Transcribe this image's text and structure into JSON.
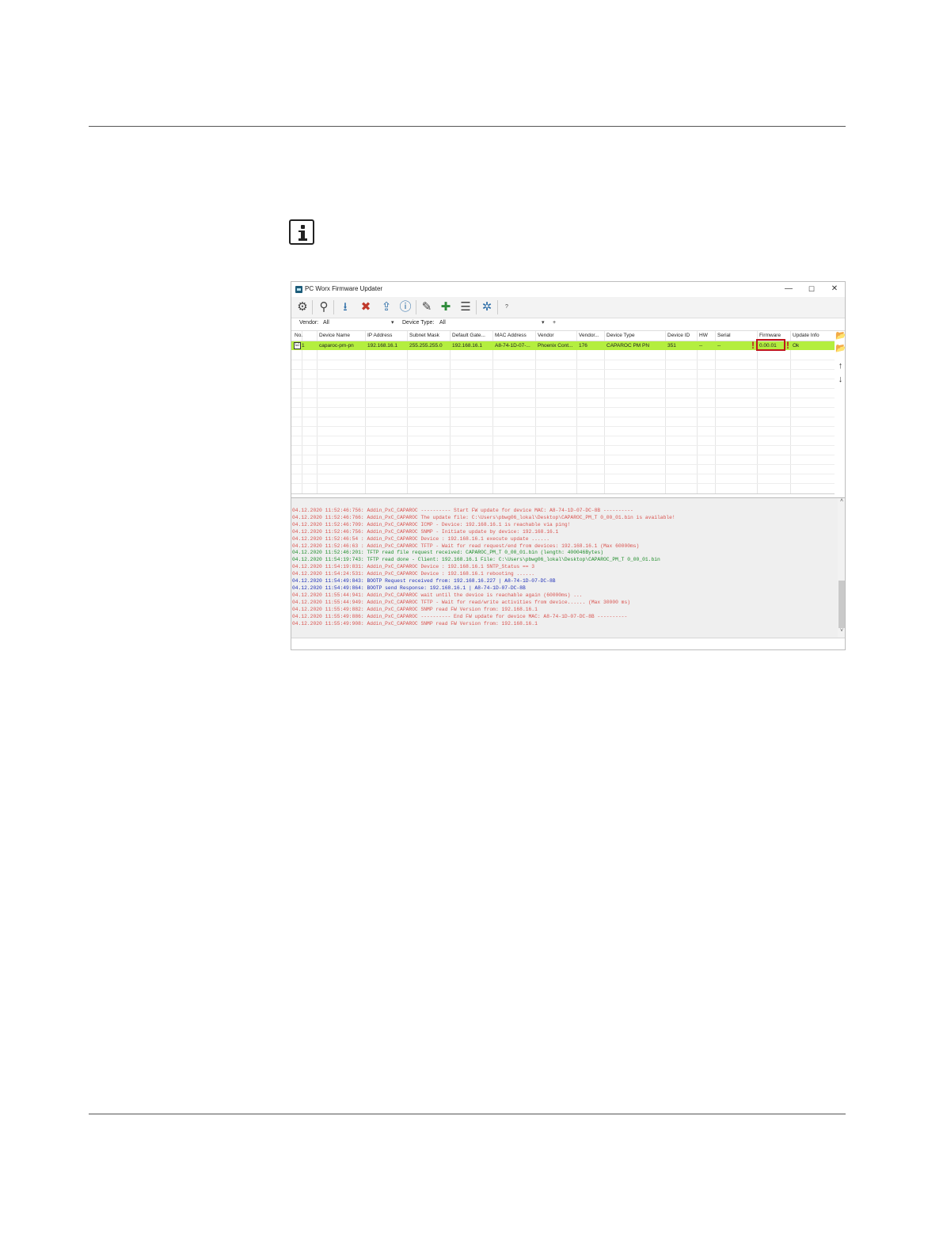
{
  "window": {
    "title": "PC Worx Firmware Updater",
    "minimize_glyph": "—",
    "maximize_glyph": "☐",
    "close_glyph": "✕"
  },
  "toolbar": {
    "help_label": "?",
    "icons": [
      "gear-icon",
      "search-icon",
      "download-icon",
      "search-remove-icon",
      "device-upload-icon",
      "info-upload-icon",
      "edit-minus-icon",
      "add-icon",
      "search-list-icon",
      "settings-icon"
    ]
  },
  "filters": {
    "vendor_label": "Vendor:",
    "vendor_value": "All",
    "device_type_label": "Device Type:",
    "device_type_value": "All",
    "add_glyph": "+"
  },
  "grid": {
    "columns": [
      "No.",
      "Device Name",
      "IP Address",
      "Subnet Mask",
      "Default Gate...",
      "MAC Address",
      "Vendor",
      "Vendor...",
      "Device Type",
      "Device ID",
      "HW",
      "Serial",
      "Firmware",
      "Update Info"
    ],
    "rows": [
      {
        "no": "1",
        "device_name": "caparoc-pm-pn",
        "ip": "192.168.16.1",
        "subnet": "255.255.255.0",
        "gateway": "192.168.16.1",
        "mac": "A8-74-1D-07-...",
        "vendor": "Phoenix Cont...",
        "vendor_id": "176",
        "device_type": "CAPAROC PM PN",
        "device_id": "351",
        "hw": "--",
        "serial": "--",
        "firmware": "0.00.01",
        "update_info": "Ok",
        "checked": "☑"
      }
    ],
    "warn_glyph": "!"
  },
  "side_icons": {
    "open_folder_1": "📂",
    "open_folder_2": "📂",
    "up_arrow": "↑",
    "down_arrow": "↓"
  },
  "log": {
    "colors": {
      "red": "#d9534f",
      "green": "#1e8c2a",
      "blue": "#2030b8"
    },
    "lines": [
      {
        "text": "04.12.2020 11:52:46:756: Addin_PxC_CAPAROC ---------- Start FW update for device MAC: A8-74-1D-07-DC-8B ----------",
        "color": "red"
      },
      {
        "text": "04.12.2020 11:52:46:766: Addin_PxC_CAPAROC The update file: C:\\Users\\pbwg06_lokal\\Desktop\\CAPAROC_PM_T 0_00_01.bin is available!",
        "color": "red"
      },
      {
        "text": "04.12.2020 11:52:46:709: Addin_PxC_CAPAROC ICMP - Device: 192.168.16.1 is reachable via ping!",
        "color": "red"
      },
      {
        "text": "04.12.2020 11:52:46:756: Addin_PxC_CAPAROC SNMP - Initiate update by device: 192.168.16.1",
        "color": "red"
      },
      {
        "text": "04.12.2020 11:52:46:54 : Addin_PxC_CAPAROC Device : 192.168.16.1 execute update ......",
        "color": "red"
      },
      {
        "text": "04.12.2020 11:52:46:63 : Addin_PxC_CAPAROC TFTP - Wait for read request/end from devices: 192.168.16.1 (Max 60000ms)",
        "color": "red"
      },
      {
        "text": "04.12.2020 11:52:46:201: TFTP read file request received: CAPAROC_PM_T 0_00_01.bin (length: 400046Bytes)",
        "color": "green"
      },
      {
        "text": "04.12.2020 11:54:19:743: TFTP read done - Client: 192.168.16.1 File: C:\\Users\\pbwg06_lokal\\Desktop\\CAPAROC_PM_T 0_00_01.bin",
        "color": "green"
      },
      {
        "text": "04.12.2020 11:54:19:831: Addin_PxC_CAPAROC Device : 192.168.16.1 SNTP_Status == 3",
        "color": "red"
      },
      {
        "text": "04.12.2020 11:54:24:531: Addin_PxC_CAPAROC Device : 192.168.16.1 rebooting ......",
        "color": "red"
      },
      {
        "text": "04.12.2020 11:54:49:843: BOOTP Request received from: 192.168.16.227 | A8-74-1D-07-DC-8B",
        "color": "blue"
      },
      {
        "text": "04.12.2020 11:54:49:864: BOOTP send Response: 192.168.16.1 | A8-74-1D-07-DC-8B",
        "color": "blue"
      },
      {
        "text": "04.12.2020 11:55:44:941: Addin_PxC_CAPAROC wait until the device is reachable again (60000ms) ...",
        "color": "red"
      },
      {
        "text": "04.12.2020 11:55:44:949: Addin_PxC_CAPAROC TFTP - Wait for read/write activities from device...... (Max 30000 ms)",
        "color": "red"
      },
      {
        "text": "04.12.2020 11:55:49:882: Addin_PxC_CAPAROC SNMP read FW Version from: 192.168.16.1",
        "color": "red"
      },
      {
        "text": "04.12.2020 11:55:49:886: Addin_PxC_CAPAROC ---------- End FW update for device MAC: A8-74-1D-07-DC-8B ----------",
        "color": "red"
      },
      {
        "text": "04.12.2020 11:55:49:908: Addin_PxC_CAPAROC SNMP read FW Version from: 192.168.16.1",
        "color": "red"
      }
    ],
    "scroll_up": "˄",
    "scroll_down": "˅"
  }
}
